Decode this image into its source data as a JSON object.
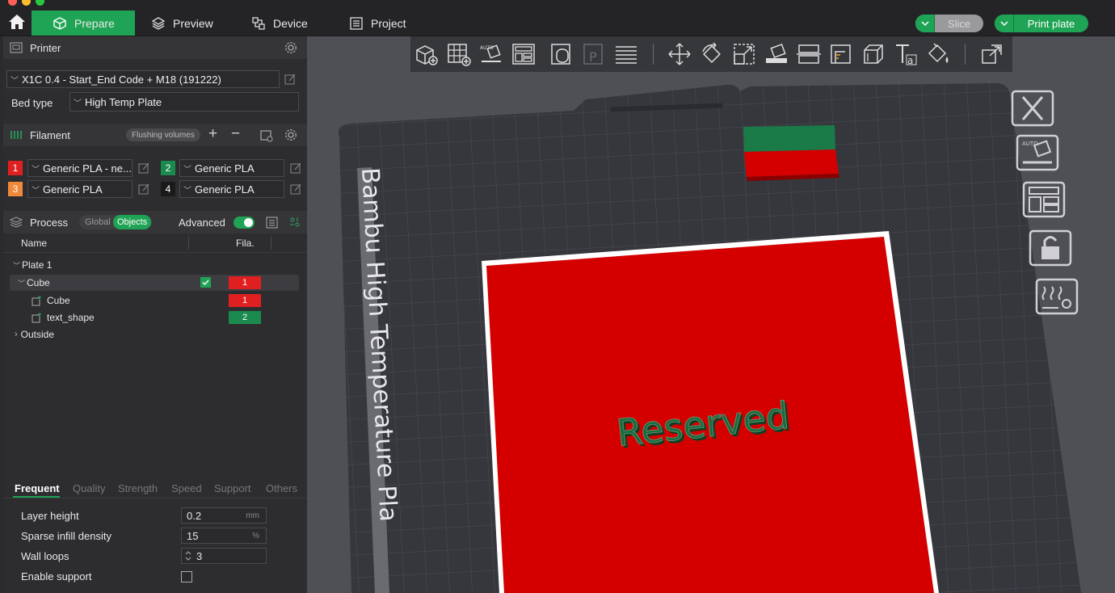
{
  "tabs": {
    "prepare": "Prepare",
    "preview": "Preview",
    "device": "Device",
    "project": "Project"
  },
  "actions": {
    "slice": "Slice",
    "print_plate": "Print plate"
  },
  "printer": {
    "section": "Printer",
    "profile": "X1C 0.4 - Start_End Code + M18 (191222)",
    "bed_type_label": "Bed type",
    "bed_type": "High Temp Plate"
  },
  "filament": {
    "section": "Filament",
    "flushing": "Flushing volumes",
    "plus": "+",
    "minus": "−",
    "slots": [
      {
        "num": "1",
        "name": "Generic PLA - ne...",
        "color": "#e02020"
      },
      {
        "num": "2",
        "name": "Generic PLA",
        "color": "#1a8a4e"
      },
      {
        "num": "3",
        "name": "Generic PLA",
        "color": "#f08a3a"
      },
      {
        "num": "4",
        "name": "Generic PLA",
        "color": "#1a1a1a"
      }
    ]
  },
  "process": {
    "section": "Process",
    "global": "Global",
    "objects": "Objects",
    "advanced": "Advanced"
  },
  "tree": {
    "col_name": "Name",
    "col_fila": "Fila.",
    "rows": [
      {
        "label": "Plate 1"
      },
      {
        "label": "Cube",
        "fila": "1"
      },
      {
        "label": "Cube",
        "fila": "1"
      },
      {
        "label": "text_shape",
        "fila": "2"
      },
      {
        "label": "Outside"
      }
    ]
  },
  "subtabs": [
    "Frequent",
    "Quality",
    "Strength",
    "Speed",
    "Support",
    "Others"
  ],
  "params": {
    "layer_height": {
      "label": "Layer height",
      "value": "0.2",
      "unit": "mm"
    },
    "sparse_infill": {
      "label": "Sparse infill density",
      "value": "15",
      "unit": "%"
    },
    "wall_loops": {
      "label": "Wall loops",
      "value": "3"
    },
    "enable_support": {
      "label": "Enable support"
    }
  },
  "scene": {
    "plate_label": "Bambu High Temperature Pla",
    "object_text": "Reserved"
  },
  "colors": {
    "accent": "#1fa354",
    "red": "#d40000",
    "green": "#1a7a48"
  }
}
